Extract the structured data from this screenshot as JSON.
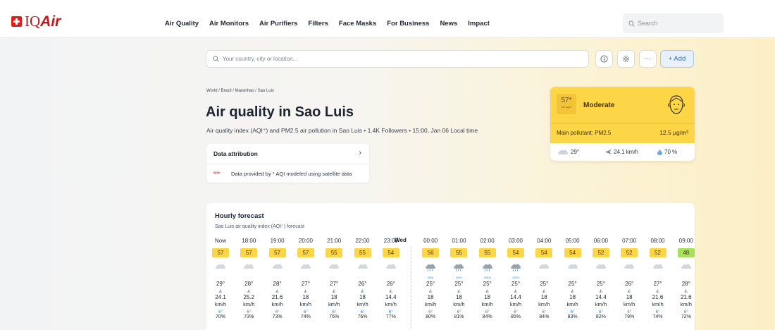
{
  "brand": {
    "logo_text_1": "IQ",
    "logo_text_2": "Air"
  },
  "nav": {
    "items": [
      "Air Quality",
      "Air Monitors",
      "Air Purifiers",
      "Filters",
      "Face Masks",
      "For Business",
      "News",
      "Impact"
    ]
  },
  "top_search": {
    "placeholder": "Search"
  },
  "location_search": {
    "placeholder": "Your country, city or location..."
  },
  "actions": {
    "add_label": "+ Add",
    "more_label": "···"
  },
  "breadcrumb": "World / Brazil / Maranhao / Sao Luis",
  "page": {
    "title": "Air quality in Sao Luis",
    "subtitle": "Air quality index (AQI⁺) and PM2.5 air pollution in Sao Luis • 1.4K Followers • 15:00, Jan 06 Local time"
  },
  "attribution": {
    "header": "Data attribution",
    "logo_text": "IQAir",
    "text": "Data provided by * AQI modeled using satellite data"
  },
  "aqi_card": {
    "value": "57*",
    "unit": "US AQI*",
    "level": "Moderate",
    "pollutant": "Main pollutant: PM2.5",
    "concentration": "12.5 µg/m³",
    "temperature": "29°",
    "wind": "24.1 km/h",
    "humidity": "70 %",
    "colors": {
      "moderate": "#fcd647",
      "badge": "#f3c436"
    }
  },
  "forecast": {
    "title": "Hourly forecast",
    "subtitle": "Sao Luis air quality index (AQI⁺) forecast",
    "day_label": "Wed",
    "speed_unit": "km/h",
    "drop_icon": "6°",
    "wind_icon": "◭",
    "colors": {
      "moderate": "#fcd647",
      "good": "#a8e05f"
    },
    "hours": [
      {
        "time": "Now",
        "aqi": "57",
        "level": "moderate",
        "temp": "29°",
        "speed": "24.1",
        "humidity": "70%",
        "rain": ""
      },
      {
        "time": "18:00",
        "aqi": "57",
        "level": "moderate",
        "temp": "28°",
        "speed": "25.2",
        "humidity": "73%",
        "rain": ""
      },
      {
        "time": "19:00",
        "aqi": "57",
        "level": "moderate",
        "temp": "28°",
        "speed": "21.6",
        "humidity": "73%",
        "rain": ""
      },
      {
        "time": "20:00",
        "aqi": "57",
        "level": "moderate",
        "temp": "27°",
        "speed": "18",
        "humidity": "74%",
        "rain": ""
      },
      {
        "time": "21:00",
        "aqi": "55",
        "level": "moderate",
        "temp": "27°",
        "speed": "18",
        "humidity": "76%",
        "rain": ""
      },
      {
        "time": "22:00",
        "aqi": "55",
        "level": "moderate",
        "temp": "26°",
        "speed": "18",
        "humidity": "76%",
        "rain": ""
      },
      {
        "time": "23:00",
        "aqi": "54",
        "level": "moderate",
        "temp": "26°",
        "speed": "14.4",
        "humidity": "77%",
        "rain": ""
      },
      {
        "time": "00:00",
        "aqi": "56",
        "level": "moderate",
        "temp": "25°",
        "speed": "18",
        "humidity": "80%",
        "rain": "30%"
      },
      {
        "time": "01:00",
        "aqi": "55",
        "level": "moderate",
        "temp": "25°",
        "speed": "18",
        "humidity": "81%",
        "rain": "80%"
      },
      {
        "time": "02:00",
        "aqi": "55",
        "level": "moderate",
        "temp": "25°",
        "speed": "18",
        "humidity": "84%",
        "rain": "100%"
      },
      {
        "time": "03:00",
        "aqi": "54",
        "level": "moderate",
        "temp": "25°",
        "speed": "14.4",
        "humidity": "85%",
        "rain": "100%"
      },
      {
        "time": "04:00",
        "aqi": "54",
        "level": "moderate",
        "temp": "25°",
        "speed": "18",
        "humidity": "84%",
        "rain": ""
      },
      {
        "time": "05:00",
        "aqi": "54",
        "level": "moderate",
        "temp": "25°",
        "speed": "18",
        "humidity": "83%",
        "rain": ""
      },
      {
        "time": "06:00",
        "aqi": "52",
        "level": "moderate",
        "temp": "25°",
        "speed": "14.4",
        "humidity": "82%",
        "rain": ""
      },
      {
        "time": "07:00",
        "aqi": "52",
        "level": "moderate",
        "temp": "26°",
        "speed": "18",
        "humidity": "79%",
        "rain": ""
      },
      {
        "time": "08:00",
        "aqi": "52",
        "level": "moderate",
        "temp": "27°",
        "speed": "21.6",
        "humidity": "74%",
        "rain": ""
      },
      {
        "time": "09:00",
        "aqi": "48",
        "level": "good",
        "temp": "28°",
        "speed": "21.6",
        "humidity": "72%",
        "rain": ""
      }
    ]
  }
}
